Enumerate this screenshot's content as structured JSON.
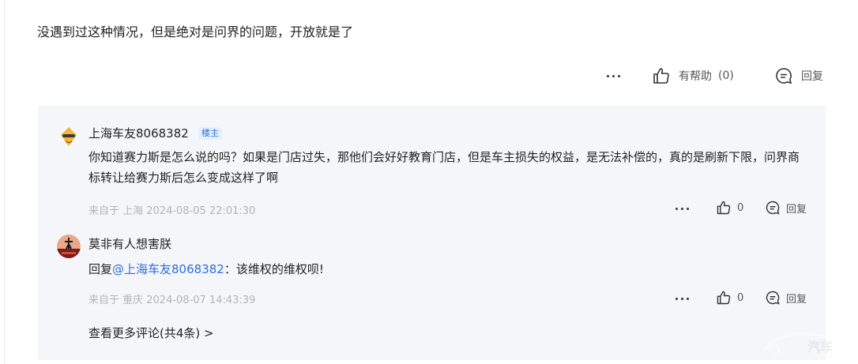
{
  "main_comment": {
    "text": "没遇到过这种情况，但是绝对是问界的问题，开放就是了",
    "helpful_label": "有帮助",
    "helpful_count": "(0)",
    "reply_label": "回复"
  },
  "replies": [
    {
      "username": "上海车友8068382",
      "badge": "楼主",
      "text": "你知道赛力斯是怎么说的吗？如果是门店过失，那他们会好好教育门店，但是车主损失的权益，是无法补偿的，真的是刷新下限，问界商标转让给赛力斯后怎么变成这样了啊",
      "meta": "来自于 上海 2024-08-05 22:01:30",
      "like_count": "0",
      "reply_label": "回复"
    },
    {
      "username": "莫非有人想害朕",
      "reply_prefix": "回复",
      "mention": "@上海车友8068382",
      "text_suffix": "：该维权的维权呗!",
      "meta": "来自于 重庆 2024-08-07 14:43:39",
      "like_count": "0",
      "reply_label": "回复"
    }
  ],
  "view_more": "查看更多评论(共4条) >",
  "watermark_text": "汽车"
}
